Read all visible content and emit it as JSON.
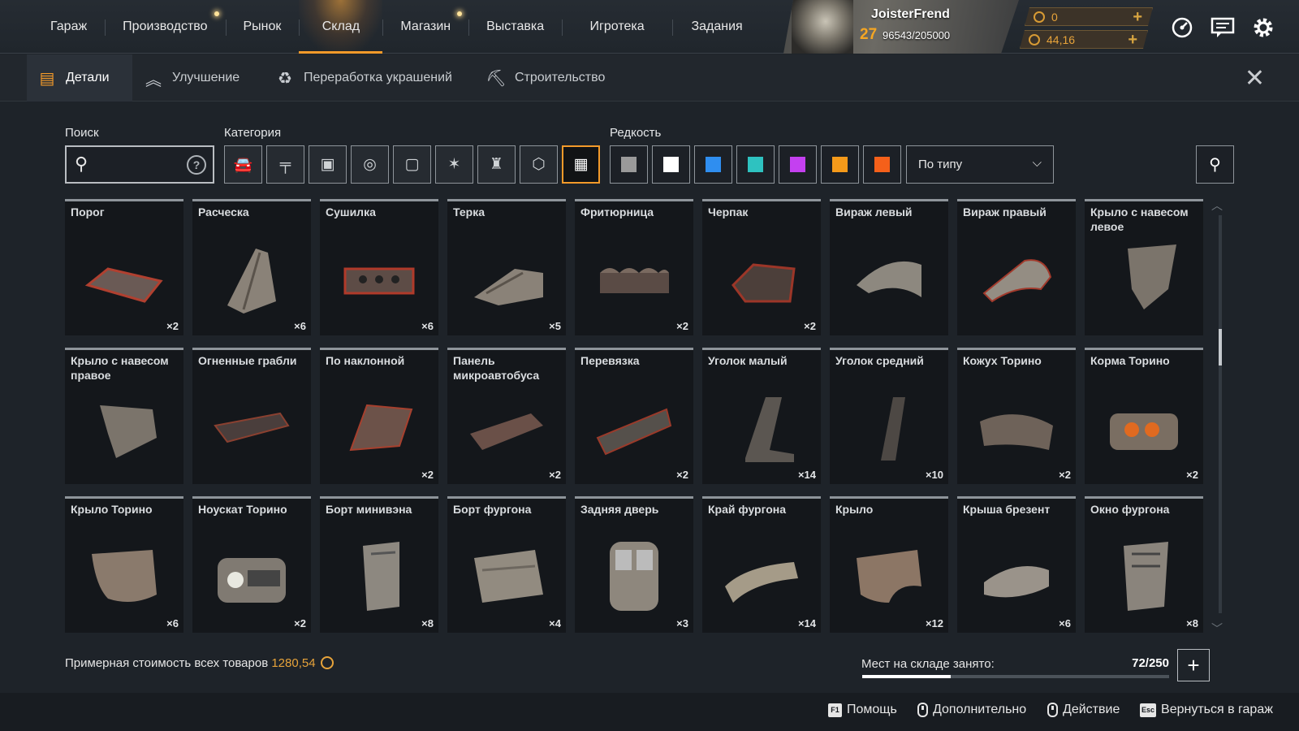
{
  "nav": {
    "items": [
      {
        "label": "Гараж",
        "dot": false
      },
      {
        "label": "Производство",
        "dot": true
      },
      {
        "label": "Рынок",
        "dot": false
      },
      {
        "label": "Склад",
        "dot": false,
        "active": true
      },
      {
        "label": "Магазин",
        "dot": true
      },
      {
        "label": "Выставка",
        "dot": false
      },
      {
        "label": "Игротека",
        "dot": false
      },
      {
        "label": "Задания",
        "dot": false
      }
    ]
  },
  "profile": {
    "name": "JoisterFrend",
    "level": "27",
    "xp": "96543/205000"
  },
  "currency": {
    "coins": "0",
    "crystals": "44,16"
  },
  "subtabs": [
    "Детали",
    "Улучшение",
    "Переработка украшений",
    "Строительство"
  ],
  "filters": {
    "search_label": "Поиск",
    "search_placeholder": "",
    "category_label": "Категория",
    "rarity_label": "Редкость",
    "sort_value": "По типу",
    "rarity_colors": [
      "#9a9a9a",
      "#ffffff",
      "#2f8ef0",
      "#2ec2c0",
      "#c440f0",
      "#f59a1a",
      "#f5601a"
    ],
    "category_icons": [
      "car-icon",
      "weapon-icon",
      "module-icon",
      "wheel-icon",
      "frame-icon",
      "decor-icon",
      "paint-icon",
      "resources-icon",
      "all-icon"
    ]
  },
  "items": [
    {
      "name": "Порог",
      "qty": "×2"
    },
    {
      "name": "Расческа",
      "qty": "×6"
    },
    {
      "name": "Сушилка",
      "qty": "×6"
    },
    {
      "name": "Терка",
      "qty": "×5"
    },
    {
      "name": "Фритюрница",
      "qty": "×2"
    },
    {
      "name": "Черпак",
      "qty": "×2"
    },
    {
      "name": "Вираж левый",
      "qty": ""
    },
    {
      "name": "Вираж правый",
      "qty": ""
    },
    {
      "name": "Крыло с навесом левое",
      "qty": ""
    },
    {
      "name": "Крыло с навесом правое",
      "qty": ""
    },
    {
      "name": "Огненные грабли",
      "qty": ""
    },
    {
      "name": "По наклонной",
      "qty": "×2"
    },
    {
      "name": "Панель микроавтобуса",
      "qty": "×2"
    },
    {
      "name": "Перевязка",
      "qty": "×2"
    },
    {
      "name": "Уголок малый",
      "qty": "×14"
    },
    {
      "name": "Уголок средний",
      "qty": "×10"
    },
    {
      "name": "Кожух Торино",
      "qty": "×2"
    },
    {
      "name": "Корма Торино",
      "qty": "×2"
    },
    {
      "name": "Крыло Торино",
      "qty": "×6"
    },
    {
      "name": "Ноускат Торино",
      "qty": "×2"
    },
    {
      "name": "Борт минивэна",
      "qty": "×8"
    },
    {
      "name": "Борт фургона",
      "qty": "×4"
    },
    {
      "name": "Задняя дверь",
      "qty": "×3"
    },
    {
      "name": "Край фургона",
      "qty": "×14"
    },
    {
      "name": "Крыло",
      "qty": "×12"
    },
    {
      "name": "Крыша брезент",
      "qty": "×6"
    },
    {
      "name": "Окно фургона",
      "qty": "×8"
    }
  ],
  "footer": {
    "total_label": "Примерная стоимость всех товаров",
    "total_value": "1280,54",
    "storage_label": "Мест на складе занято:",
    "storage_value": "72/250",
    "storage_fraction": 0.288
  },
  "hotkeys": [
    {
      "key": "F1",
      "label": "Помощь"
    },
    {
      "key": "",
      "label": "Дополнительно"
    },
    {
      "key": "",
      "label": "Действие"
    },
    {
      "key": "Esc",
      "label": "Вернуться в гараж"
    }
  ]
}
